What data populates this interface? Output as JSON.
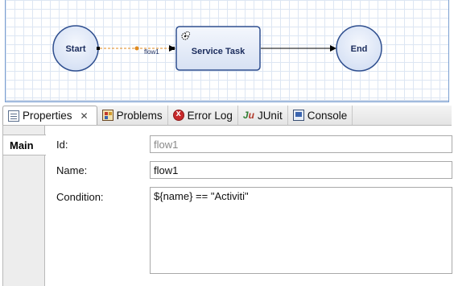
{
  "diagram": {
    "nodes": {
      "start": "Start",
      "service_task": "Service Task",
      "end": "End"
    },
    "flow_label": "flow1",
    "colors": {
      "node_fill": "#dfe7f7",
      "node_stroke": "#2f4f8f",
      "selected_flow": "#e08a1e"
    }
  },
  "tabs": [
    {
      "label": "Properties",
      "icon": "properties-icon",
      "active": true
    },
    {
      "label": "Problems",
      "icon": "problems-icon"
    },
    {
      "label": "Error Log",
      "icon": "error-log-icon"
    },
    {
      "label": "JUnit",
      "icon": "junit-icon"
    },
    {
      "label": "Console",
      "icon": "console-icon"
    }
  ],
  "close_glyph": "✕",
  "properties": {
    "side_tab": "Main",
    "id_label": "Id:",
    "id_value": "flow1",
    "name_label": "Name:",
    "name_value": "flow1",
    "condition_label": "Condition:",
    "condition_value": "${name} == \"Activiti\""
  }
}
